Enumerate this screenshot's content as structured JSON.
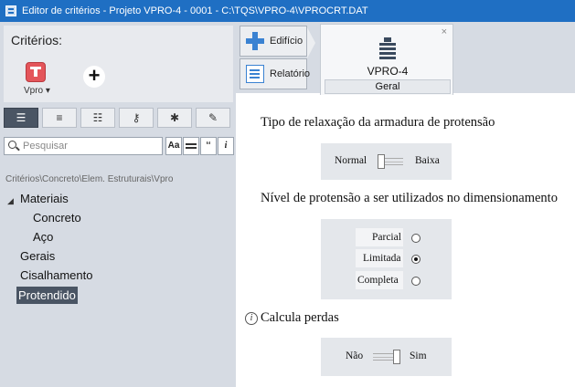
{
  "window": {
    "title": "Editor de critérios - Projeto VPRO-4 - 0001 - C:\\TQS\\VPRO-4\\VPROCRT.DAT"
  },
  "left_panel": {
    "criteria_title": "Critérios:",
    "vpro_button_label": "Vpro",
    "add_button_label": "+",
    "search": {
      "placeholder": "Pesquisar",
      "value": ""
    },
    "search_buttons": [
      "Aa",
      "",
      "‘‘",
      "i"
    ],
    "breadcrumb": "Critérios\\Concreto\\Elem. Estruturais\\Vpro",
    "tree": [
      {
        "label": "Materiais",
        "expanded": true
      },
      {
        "label": "Concreto"
      },
      {
        "label": "Aço"
      },
      {
        "label": "Gerais"
      },
      {
        "label": "Cisalhamento"
      },
      {
        "label": "Protendido",
        "selected": true
      }
    ],
    "tree_caret": "◢"
  },
  "nav": {
    "edificio_label": "Edifício",
    "relatorio_label": "Relatório"
  },
  "panel_tab": {
    "name": "VPRO-4",
    "sub": "Geral",
    "close": "×"
  },
  "content": {
    "section1": {
      "title": "Tipo de relaxação da armadura de protensão",
      "left_label": "Normal",
      "right_label": "Baixa",
      "value": "Normal"
    },
    "section2": {
      "title": "Nível de protensão a ser utilizados no dimensionamento",
      "options": [
        "Parcial",
        "Limitada",
        "Completa"
      ],
      "selected": "Limitada"
    },
    "section3": {
      "title": "Calcula perdas",
      "info_icon": "i",
      "left_label": "Não",
      "right_label": "Sim",
      "value": "Sim"
    }
  },
  "colors": {
    "titlebar": "#1f6fc3",
    "panel_bg": "#d6dbe3",
    "selected_bg": "#4a5564",
    "accent_blue": "#3a82d2",
    "vpro_red": "#e4555a"
  }
}
